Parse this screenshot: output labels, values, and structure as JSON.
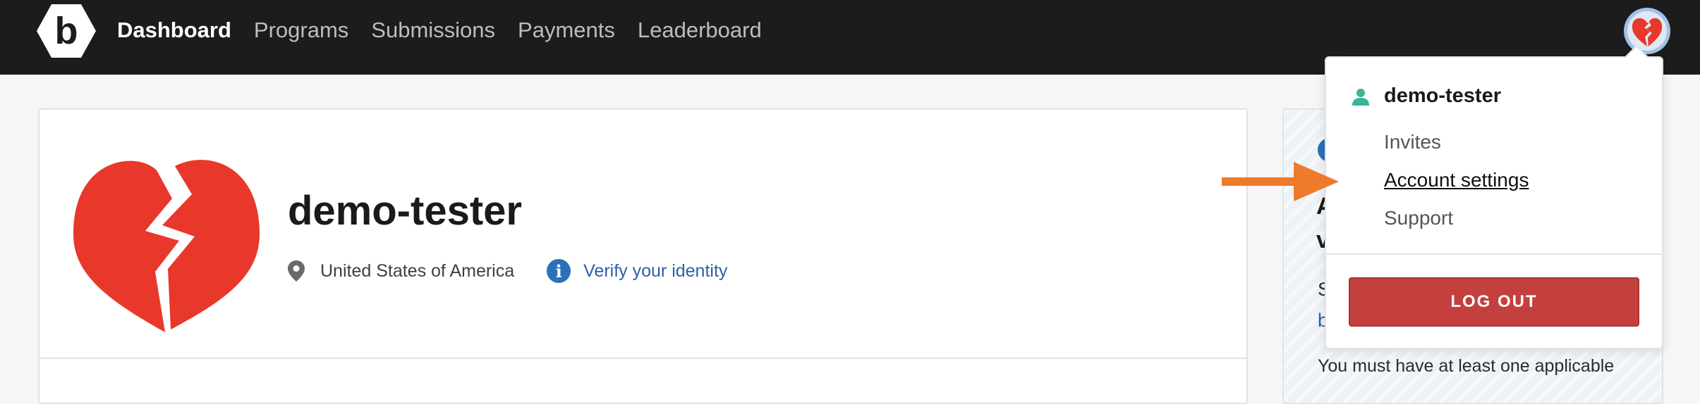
{
  "nav": {
    "logo_letter": "b",
    "items": [
      {
        "label": "Dashboard",
        "active": true
      },
      {
        "label": "Programs",
        "active": false
      },
      {
        "label": "Submissions",
        "active": false
      },
      {
        "label": "Payments",
        "active": false
      },
      {
        "label": "Leaderboard",
        "active": false
      }
    ]
  },
  "profile": {
    "username": "demo-tester",
    "country": "United States of America",
    "verify_link": "Verify your identity"
  },
  "side_card": {
    "line1": "A",
    "line2": "v",
    "line3": "S",
    "line4": "b",
    "note": "You must have at least one applicable"
  },
  "dropdown": {
    "username": "demo-tester",
    "items": [
      "Invites",
      "Account settings",
      "Support"
    ],
    "logout_label": "LOG OUT"
  },
  "colors": {
    "nav_bg": "#1c1c1c",
    "brand_red": "#e8382b",
    "link_blue": "#2d5fa8",
    "logout_red": "#c4403e",
    "user_icon_teal": "#3bb39a",
    "arrow_orange": "#ee7a2c"
  },
  "icons": {
    "logo": "bugcrowd-logo-icon",
    "avatar": "broken-heart-icon",
    "location": "map-pin-icon",
    "info": "info-circle-icon",
    "user": "user-icon"
  }
}
